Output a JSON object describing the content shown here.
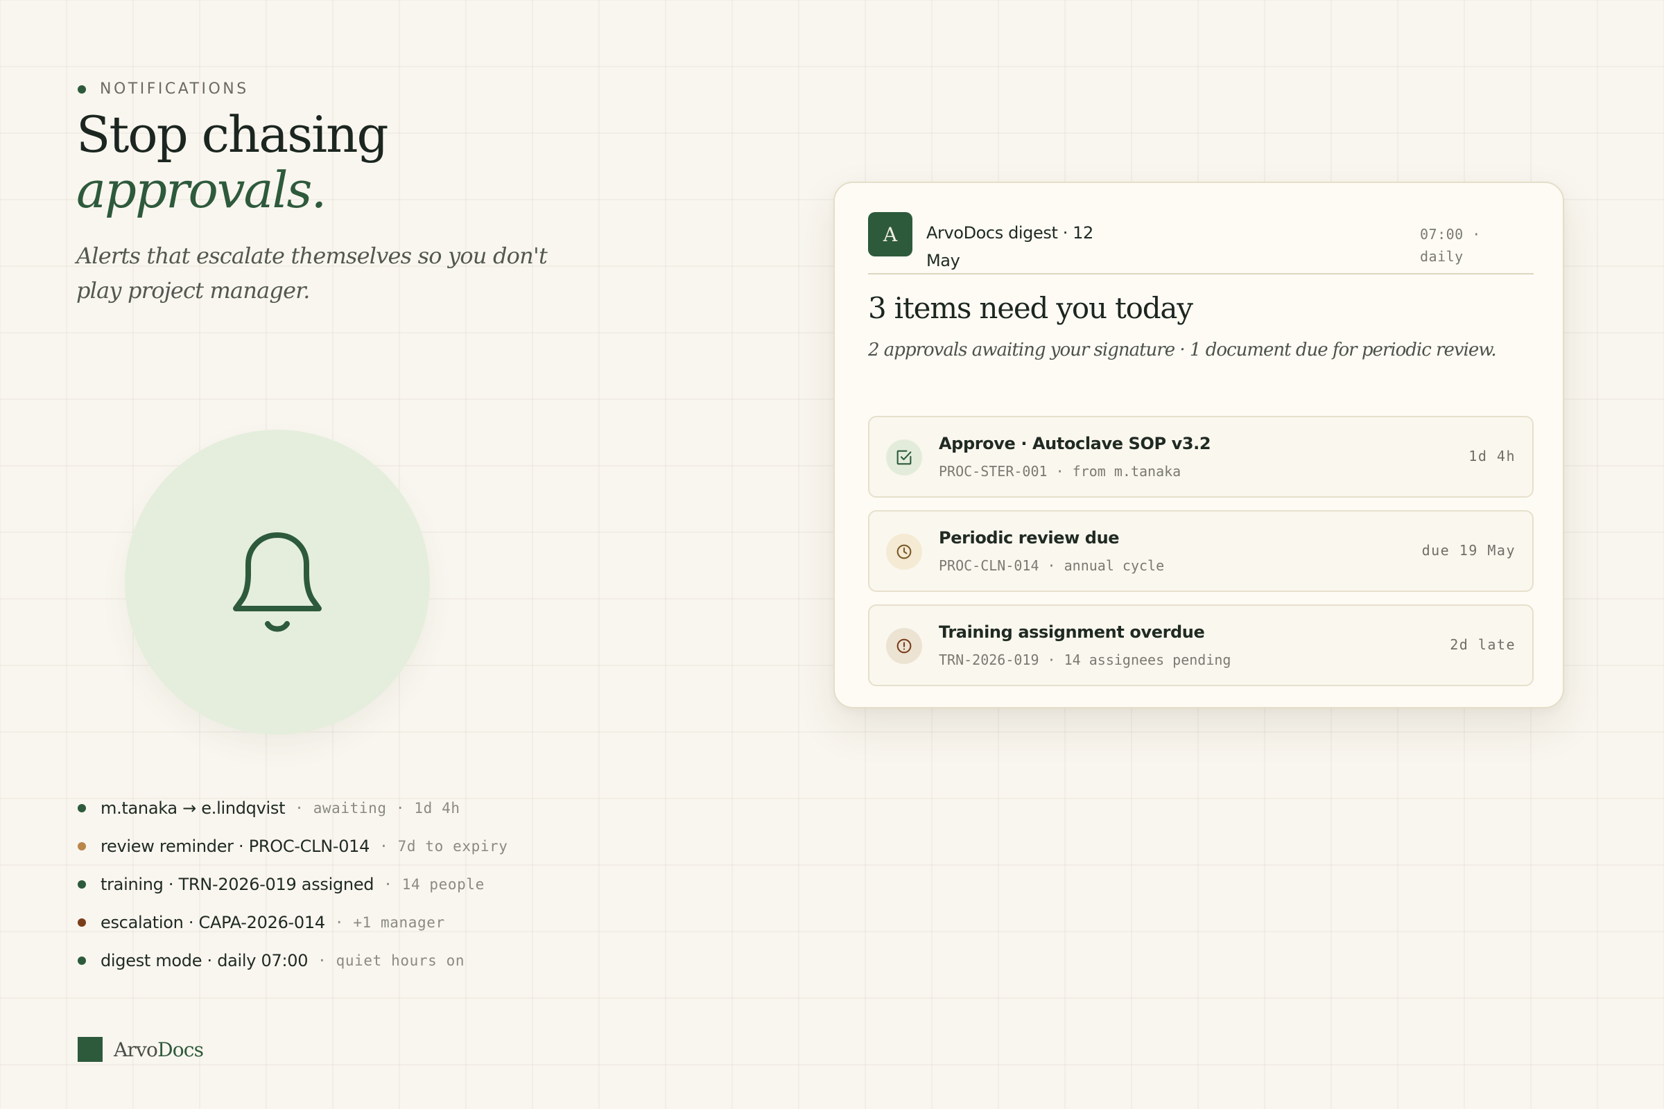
{
  "hero": {
    "eyebrow": "NOTIFICATIONS",
    "headline_line1": "Stop chasing",
    "headline_line2": "approvals.",
    "subhead": "Alerts that escalate themselves so you don't play project manager."
  },
  "illustration": {
    "icon": "bell-icon",
    "circle_color": "#e5eedd",
    "stroke_color": "#2e5a3c"
  },
  "activity": [
    {
      "text": "m.tanaka → e.lindqvist",
      "meta": "· awaiting · 1d 4h",
      "dot_color": "#2e5a3c"
    },
    {
      "text": "review reminder · PROC-CLN-014",
      "meta": "· 7d to expiry",
      "dot_color": "#b8874a"
    },
    {
      "text": "training · TRN-2026-019 assigned",
      "meta": "· 14 people",
      "dot_color": "#2e5a3c"
    },
    {
      "text": "escalation · CAPA-2026-014",
      "meta": "· +1 manager",
      "dot_color": "#7a3e1c"
    },
    {
      "text": "digest mode · daily 07:00",
      "meta": "· quiet hours on",
      "dot_color": "#2e5a3c"
    }
  ],
  "brand": {
    "name_part1": "Arvo",
    "name_part2": "Docs",
    "color": "#2e5a3c"
  },
  "digest": {
    "avatar_letter": "A",
    "sender": "ArvoDocs digest · 12 May",
    "time": "07:00 · daily",
    "title": "3 items need you today",
    "summary": "2 approvals awaiting your signature · 1 document due for periodic review.",
    "items": [
      {
        "icon": "checkbox-icon",
        "icon_bg": "#e3ecda",
        "icon_color": "#2e5a3c",
        "title": "Approve · Autoclave SOP v3.2",
        "sub": "PROC-STER-001 · from m.tanaka",
        "right": "1d 4h"
      },
      {
        "icon": "clock-icon",
        "icon_bg": "#f5ead3",
        "icon_color": "#7a5a2a",
        "title": "Periodic review due",
        "sub": "PROC-CLN-014 · annual cycle",
        "right": "due 19 May"
      },
      {
        "icon": "alert-circle-icon",
        "icon_bg": "#ede3d3",
        "icon_color": "#7a3e1c",
        "title": "Training assignment overdue",
        "sub": "TRN-2026-019 · 14 assignees pending",
        "right": "2d late"
      }
    ]
  },
  "colors": {
    "background": "#f9f6ef",
    "accent": "#2e5a3c",
    "card_bg": "#fdfbf4"
  }
}
